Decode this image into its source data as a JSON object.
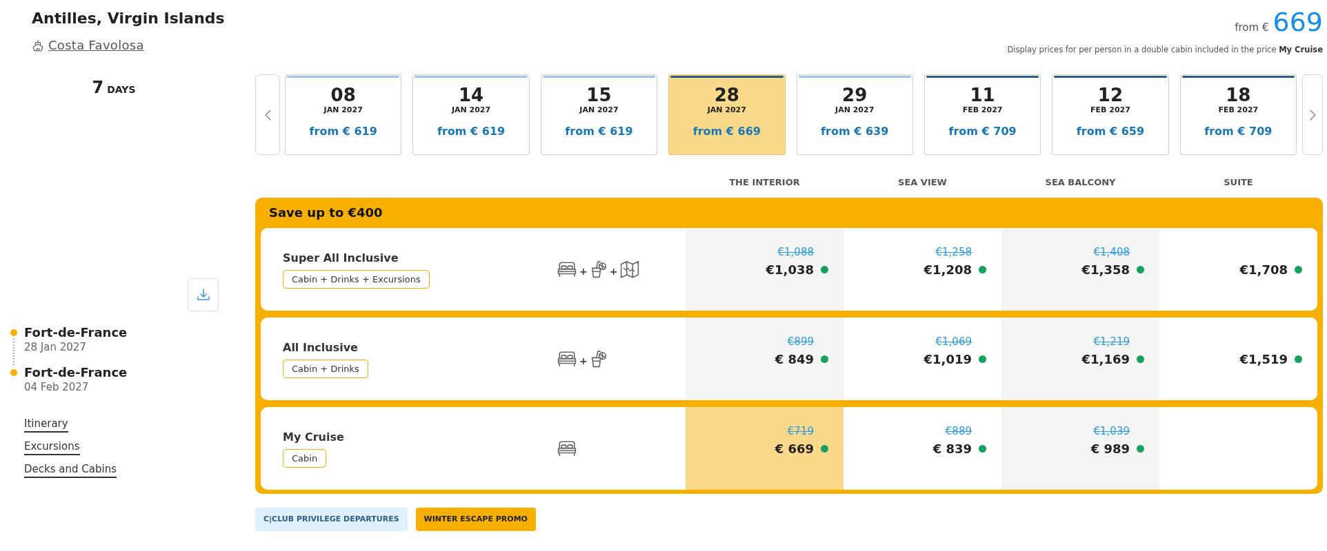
{
  "header": {
    "title": "Antilles, Virgin Islands",
    "ship": "Costa Favolosa",
    "price_prefix": "from €",
    "price": "669",
    "note": "Display prices for per person in a double cabin included in the price **My Cruise**"
  },
  "sidebar": {
    "duration": {
      "number": "7",
      "unit": "DAYS"
    },
    "stops": [
      {
        "port": "Fort-de-France",
        "date": "28 Jan 2027"
      },
      {
        "port": "Fort-de-France",
        "date": "04 Feb 2027"
      }
    ],
    "links": [
      "Itinerary",
      "Excursions",
      "Decks and Cabins"
    ]
  },
  "dates": [
    {
      "day": "08",
      "month": "JAN 2027",
      "price": "from € 619",
      "color": "#a0c4e8",
      "selected": false
    },
    {
      "day": "14",
      "month": "JAN 2027",
      "price": "from € 619",
      "color": "#a0c4e8",
      "selected": false
    },
    {
      "day": "15",
      "month": "JAN 2027",
      "price": "from € 619",
      "color": "#a0c4e8",
      "selected": false
    },
    {
      "day": "28",
      "month": "JAN 2027",
      "price": "from € 669",
      "color": "#2c5b86",
      "selected": true
    },
    {
      "day": "29",
      "month": "JAN 2027",
      "price": "from € 639",
      "color": "#a0c4e8",
      "selected": false
    },
    {
      "day": "11",
      "month": "FEB 2027",
      "price": "from € 709",
      "color": "#2c5b86",
      "selected": false
    },
    {
      "day": "12",
      "month": "FEB 2027",
      "price": "from € 659",
      "color": "#2c5b86",
      "selected": false
    },
    {
      "day": "18",
      "month": "FEB 2027",
      "price": "from € 709",
      "color": "#2c5b86",
      "selected": false
    }
  ],
  "fares": {
    "columns": [
      "THE INTERIOR",
      "SEA VIEW",
      "SEA BALCONY",
      "SUITE"
    ],
    "banner": "Save up to €400",
    "rows": [
      {
        "name": "Super All Inclusive",
        "tag": "Cabin + Drinks + Excursions",
        "amenities": [
          {
            "kind": "cabin"
          },
          {
            "kind": "separator",
            "text": "+"
          },
          {
            "kind": "drinks"
          },
          {
            "kind": "separator",
            "text": "+"
          },
          {
            "kind": "excursions"
          }
        ],
        "prices": [
          {
            "old": "€1,088",
            "price": "€1,038",
            "available": true,
            "selected": false
          },
          {
            "old": "€1,258",
            "price": "€1,208",
            "available": true,
            "selected": false
          },
          {
            "old": "€1,408",
            "price": "€1,358",
            "available": true,
            "selected": false
          },
          {
            "price": "€1,708",
            "available": true,
            "selected": false
          }
        ]
      },
      {
        "name": "All Inclusive",
        "tag": "Cabin + Drinks",
        "amenities": [
          {
            "kind": "cabin"
          },
          {
            "kind": "separator",
            "text": "+"
          },
          {
            "kind": "drinks"
          }
        ],
        "prices": [
          {
            "old": "€899",
            "price": "€ 849",
            "available": true,
            "selected": false
          },
          {
            "old": "€1,069",
            "price": "€1,019",
            "available": true,
            "selected": false
          },
          {
            "old": "€1,219",
            "price": "€1,169",
            "available": true,
            "selected": false
          },
          {
            "price": "€1,519",
            "available": true,
            "selected": false
          }
        ]
      },
      {
        "name": "My Cruise",
        "tag": "Cabin",
        "amenities": [
          {
            "kind": "cabin"
          }
        ],
        "prices": [
          {
            "old": "€719",
            "price": "€ 669",
            "available": true,
            "selected": true
          },
          {
            "old": "€889",
            "price": "€ 839",
            "available": true,
            "selected": false
          },
          {
            "old": "€1,039",
            "price": "€ 989",
            "available": true,
            "selected": false
          }
        ]
      }
    ]
  },
  "tags": [
    {
      "kind": "club",
      "label": "C|CLUB PRIVILEGE DEPARTURES"
    },
    {
      "kind": "promo",
      "label": "WINTER ESCAPE PROMO"
    }
  ]
}
